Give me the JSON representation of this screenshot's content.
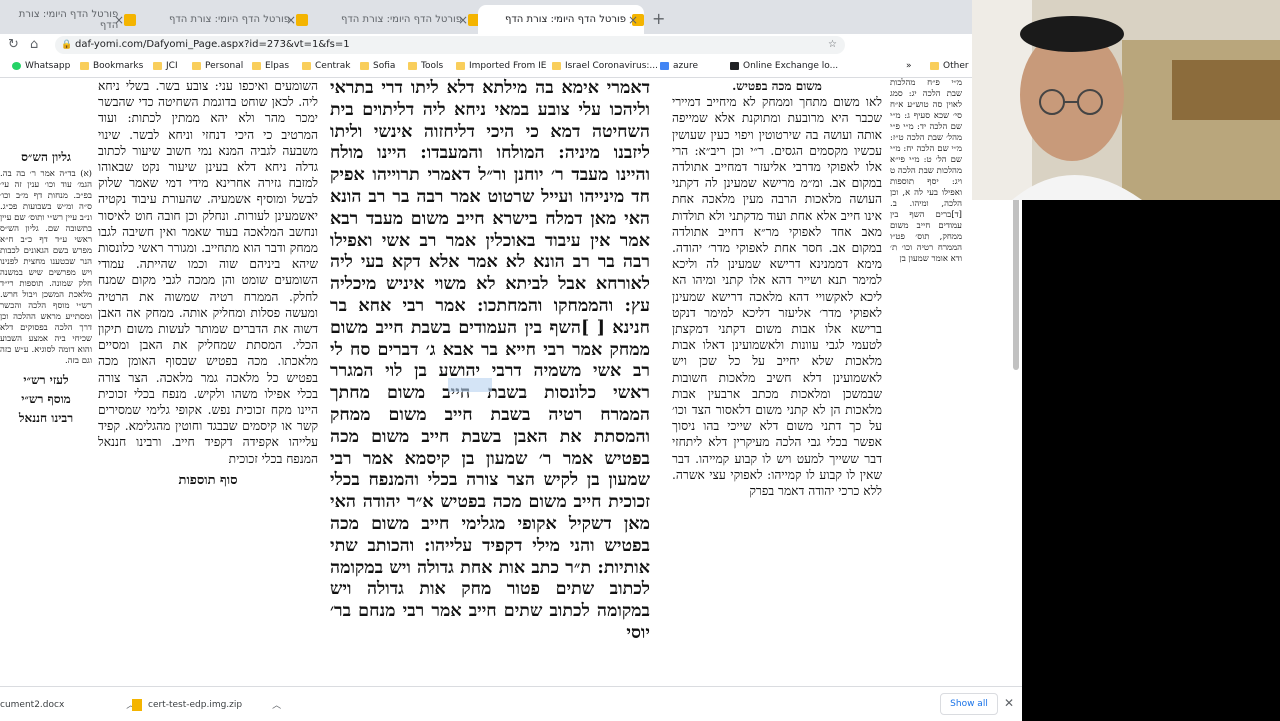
{
  "tabs": [
    {
      "title": "פורטל הדף היומי: צורת הדף",
      "active": false
    },
    {
      "title": "פורטל הדף היומי: צורת הדף",
      "active": false
    },
    {
      "title": "פורטל הדף היומי: צורת הדף",
      "active": false
    },
    {
      "title": "פורטל הדף היומי: צורת הדף",
      "active": true
    }
  ],
  "address": {
    "url": "daf-yomi.com/Dafyomi_Page.aspx?id=273&vt=1&fs=1"
  },
  "bookmarks": [
    {
      "label": "Whatsapp",
      "icon": "whatsapp-icon"
    },
    {
      "label": "Bookmarks",
      "icon": "folder-icon"
    },
    {
      "label": "JCI",
      "icon": "folder-icon"
    },
    {
      "label": "Personal",
      "icon": "folder-icon"
    },
    {
      "label": "Elpas",
      "icon": "folder-icon"
    },
    {
      "label": "Centrak",
      "icon": "folder-icon"
    },
    {
      "label": "Sofia",
      "icon": "folder-icon"
    },
    {
      "label": "Tools",
      "icon": "folder-icon"
    },
    {
      "label": "Imported From IE",
      "icon": "folder-icon"
    },
    {
      "label": "Israel Coronavirus:...",
      "icon": "folder-icon"
    },
    {
      "label": "azure",
      "icon": "doc-icon"
    },
    {
      "label": "Online Exchange lo...",
      "icon": "exchange-icon"
    }
  ],
  "bookmarks_more": "»",
  "bookmarks_other": "Other b",
  "page": {
    "main_heading": "משום מכה בפטיש.",
    "main_text": "דאמרי אימא בה מילתא דלא ליתו דרי בתראי וליהכו עלי צובע במאי ניחא ליה דליתוים בית השחיטה דמא כי היכי דליחזוה אינשי וליתו ליזבנו מיניה: המולחו והמעבדו: היינו מולח והיינו מעבד ר׳ יוחנן ור״ל דאמרי תרוייהו אפיק חד מינייהו ועייל שרטוט אמר רבה בר רב הונא האי מאן דמלח בישרא חייב משום מעבד רבא אמר אין עיבוד באוכלין אמר רב אשי ואפילו רבה בר רב הונא לא אמר אלא דקא בעי ליה לאורחא אבל לביתא לא משוי איניש מיכליה עץ: והממחקו והמחתכו: אמר רבי אחא בר חנינא [ ]השף בין העמודים בשבת חייב משום ממחק אמר רבי חייא בר אבא ג׳ דברים סח לי רב אשי משמיה דרבי יהושע בן לוי המגרר ראשי כלונסות בשבת חייב משום מחתך הממרח רטיה בשבת חייב משום ממחק והמסתת את האבן בשבת חייב משום מכה בפטיש אמר ר׳ שמעון בן קיסמא אמר רבי שמעון בן לקיש הצר צורה בכלי והמנפח בכלי זכוכית חייב משום מכה בפטיש א״ר יהודה האי מאן דשקיל אקופי מגלימי חייב משום מכה בפטיש והני מילי דקפיד עלייהו: והכותב שתי אותיות: ת״ר כתב אות אחת גדולה ויש במקומה לכתוב שתים פטור מחק אות גדולה ויש במקומה לכתוב שתים חייב אמר רבי מנחם בר׳ יוסי",
    "rashi_text": "לאו משום מתחך וממחק לא מיחייב דמיירי שכבר היא מרובעת ומתוקנת אלא שמייפה אותה ועושה בה שירטוטין ויפוי כעין שעושין עכשיו מקסמים הגסים. ר״י וכן ריב״א: הרי אלו לאפוקי מדרבי אליעזר דמחייב אתולדה במקום אב. ומ״מ מרישא שמעינן לה דקתני העושה מלאכות הרבה מעין מלאכה אחת אינו חייב אלא אחת ועוד מדקתני ולא תולדות מאב אחד לאפוקי מר״א דחייב אתולדה במקום אב. חסר אחת לאפוקי מדר׳ יהודה. מימא דממנינא דרישא שמעינן לה וליכא למימר תנא ושייר דהא אלו קתני ומיהו הא ליכא לאקשויי דהא מלאכה דרישא שמעינן לאפוקי מדר׳ אליעזר דליכא למימר דנקט ברישא אלו אבות משום דקתני דמקצתן לטעמי לגבי עוונות ולאשמועינן דאלו אבות מלאכות שלא יחייב על כל שכן ויש לאשמועינן דלא חשיב מלאכות חשובות שבמשכן ומלאכות מכתב ארבעין אבות מלאכות הן לא קתני משום דלאסור הצד וכו׳ על כך דתני משום דלא שייכי בהו ניסוך אפשר בכלי גבי הלכה מעיקרין דלא ליתחזי דבר ששייך למעט ויש לו קבוע קמייהו. דבר שאין לו קבוע לו קמייהו: לאפוקי עצי אשרה. ללא כרכי יהודה דאמר בפרק",
    "tosafot_heading": "סוף תוספות",
    "tosafot_text": "השומעים ואיכפו עני: צובע בשר. בשלי ניחא ליה. לכאן שוחט בדוגמת השחיטה כדי שהבשר ימכר מהר ולא יהא ממתין לכתות: ועוד המרטיב כי היכי דנחזי וניחא לבשר. שינוי משבעה לגביה המנא נמי חשוב שיעור לכתוב גדלה ניחא דלא בעינן שיעור נקט שבאוהו למזבח גזירה אחרינא מידי דמי שאמר שלוק לבשל ומוסיף אשמעיה. שהעורת עיבוד נקטיה יאשמעינן לעורות. ונחלק וכן חובה חוט לאיסור ונחשב המלאכה בעוד שאמר ואין חשיבה לגבו ממחק ודבר הוא מתחייב. ומגורר ראשי כלונסות שיהא ביניהם שוה וכמו שהייתה. עמודי השומעים שומט והן ממכה לגבי מקום שמנח לחלק. הממרח רטיה שמשוה את הרטיה ומעשה פסלות ומחליק אותה. ממחק אה האבן דשוה את הדברים שמותר לעשות משום תיקון הכלי. המסתת שמחליק את האבן ומסיים מלאכתו. מכה בפטיש שבסוף האומן מכה בפטיש כל מלאכה גמר מלאכה. הצר צורה בכלי אפילו משהו ולקיש. מנפח בכלי זכוכית היינו מקח זכוכית נפש. אקופי גלימי שמסירים קשר או קיסמים שבבגד וחוטין מהגלימא. קפיד עלייהו אקפידה דקפיד חייב. ורבינו חננאל המנפח בכלי זכוכית",
    "side_title": "גליון הש״ס",
    "side_title2": "לעזי רש״י",
    "side_title3": "מוסף רש״י",
    "side_title4": "רבינו חננאל",
    "side_text": "(א) בד״ה אמר ר׳ בה בה. הגמ׳ עוד וכו׳ ענין זה עי׳ בפ״ב. מנחות דף מ״ב וכו׳ ס״ה ומ״ש בשבועות פכ״ג. ונ״ב עיין רש״י ותוס׳ שם עיין בתשובה שם. גליון הש״ס ראשי ע״ד דף כ״ב ח״א מפרש בשם הגאונים לכבות הנר שבטענו מחצית לפנינו ויש מפרשים שיש במשנה חלק שמונה. תוספות רי״ד מלאכת המשכן ויבול חרש. רש״י מוסף הלכה והכשר ומסתייע מראש ההלכה וכן דרך הלכה בפסוקים דלא שכיחי ביה אמצע השבוע והוא דומה לסוגיא. ע״ש כזה וגם בזה.",
    "edge_text": "מ״י פ״ח מהלכות שבת הלכה יג: סמג לאוין סה טוש״ע א״ח סי׳ שכא סעיף ג: מ״י שם הלכה יד: מ״י פ״י מהל׳ שבת הלכה ט״ז: מ״י שם הלכה יח: מ״י שם הל׳ ט: מ״י פי״א מהלכות שבת הלכה ט ויג: יסף תוספות ואפילו בעי לה א, וכן הלכה, ומיהו. ב. [ד]ברים השף בין עמודים חייב משום ממחק, תוס׳ פט״ו הממרח רטיה וכו׳ ת׳ ודא אומר שמעון בן"
  },
  "downloads": [
    {
      "name": "cument2.docx"
    },
    {
      "name": "cert-test-edp.img.zip"
    }
  ],
  "downloads_show_all": "Show all",
  "colors": {
    "tabstrip": "#dee1e6",
    "highlight": "#b7d2f0",
    "link": "#1a73e8"
  }
}
